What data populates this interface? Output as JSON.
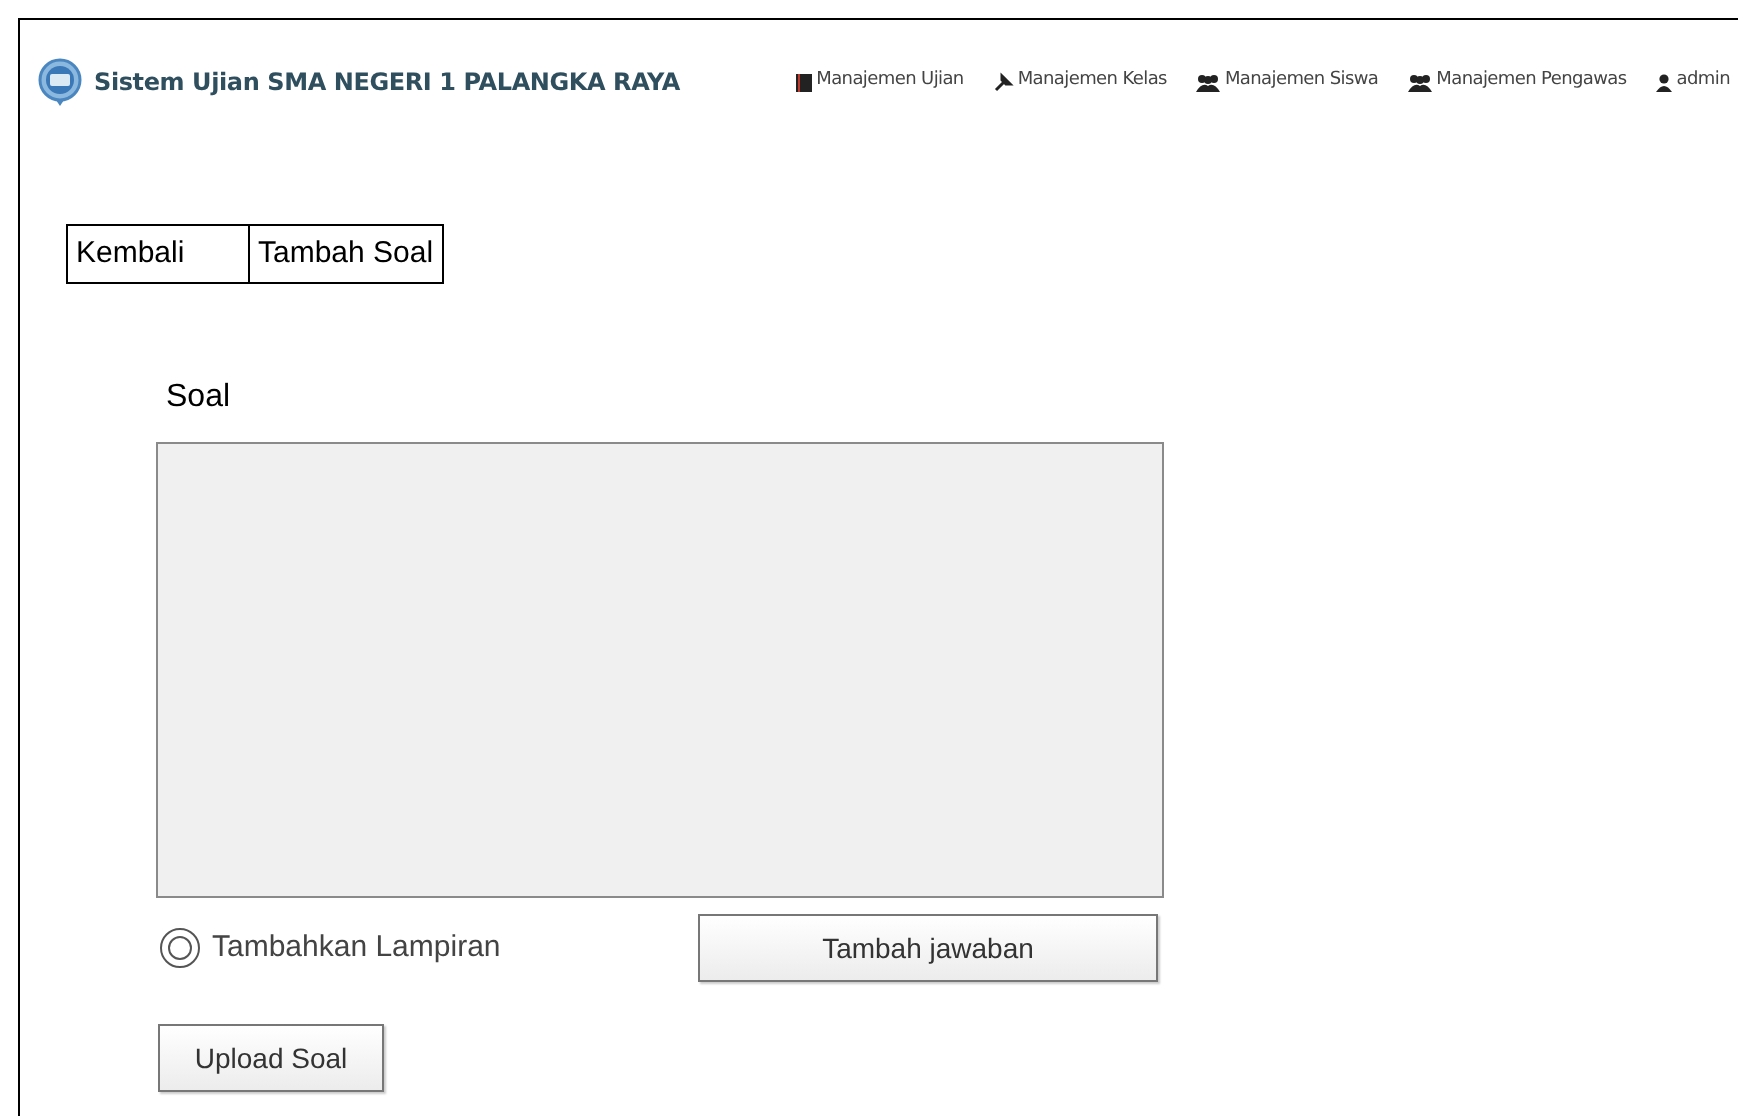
{
  "header": {
    "title": "Sistem Ujian SMA NEGERI 1 PALANGKA RAYA"
  },
  "nav": [
    {
      "label": "Manajemen Ujian"
    },
    {
      "label": "Manajemen Kelas"
    },
    {
      "label": "Manajemen Siswa"
    },
    {
      "label": "Manajemen Pengawas"
    },
    {
      "label": "admin"
    }
  ],
  "tabs": [
    {
      "label": "Kembali"
    },
    {
      "label": "Tambah Soal"
    }
  ],
  "question": {
    "label": "Soal"
  },
  "attachment": {
    "label": "Tambahkan Lampiran",
    "selected": true
  },
  "add_answer_button": "Tambah jawaban",
  "upload_button": "Upload Soal"
}
